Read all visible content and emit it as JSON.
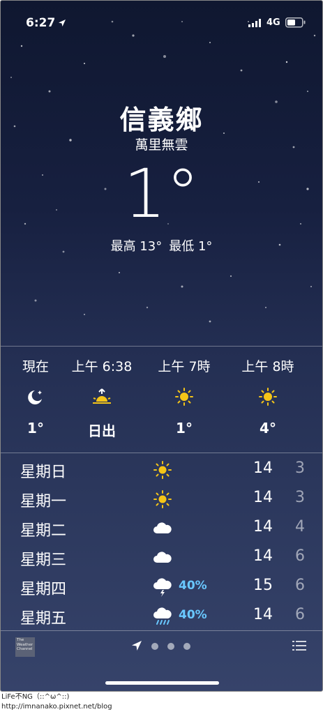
{
  "status_bar": {
    "time": "6:27",
    "network": "4G"
  },
  "location": {
    "city": "信義鄉",
    "condition": "萬里無雲",
    "temperature": "1°",
    "high": "最高 13°",
    "low": "最低 1°"
  },
  "hourly": [
    {
      "label": "現在",
      "icon": "moon-icon",
      "value": "1°"
    },
    {
      "label": "上午 6:38",
      "icon": "sunrise-icon",
      "value": "日出"
    },
    {
      "label": "上午 7時",
      "icon": "sun-icon",
      "value": "1°"
    },
    {
      "label": "上午 8時",
      "icon": "sun-icon",
      "value": "4°"
    }
  ],
  "daily": [
    {
      "day": "星期日",
      "icon": "sun-icon",
      "precip": "",
      "high": "14",
      "low": "3"
    },
    {
      "day": "星期一",
      "icon": "sun-icon",
      "precip": "",
      "high": "14",
      "low": "3"
    },
    {
      "day": "星期二",
      "icon": "cloud-icon",
      "precip": "",
      "high": "14",
      "low": "4"
    },
    {
      "day": "星期三",
      "icon": "cloud-icon",
      "precip": "",
      "high": "14",
      "low": "6"
    },
    {
      "day": "星期四",
      "icon": "thunderstorm-icon",
      "precip": "40%",
      "high": "15",
      "low": "6"
    },
    {
      "day": "星期五",
      "icon": "rain-icon",
      "precip": "40%",
      "high": "14",
      "low": "6"
    }
  ],
  "bottom_bar": {
    "logo_text": "The Weather Channel"
  },
  "watermark": {
    "line1": "LiFe不NG（::^ω^::)",
    "line2": "http://imnanako.pixnet.net/blog"
  },
  "colors": {
    "sun": "#f5c518",
    "precip": "#69c8ff"
  }
}
